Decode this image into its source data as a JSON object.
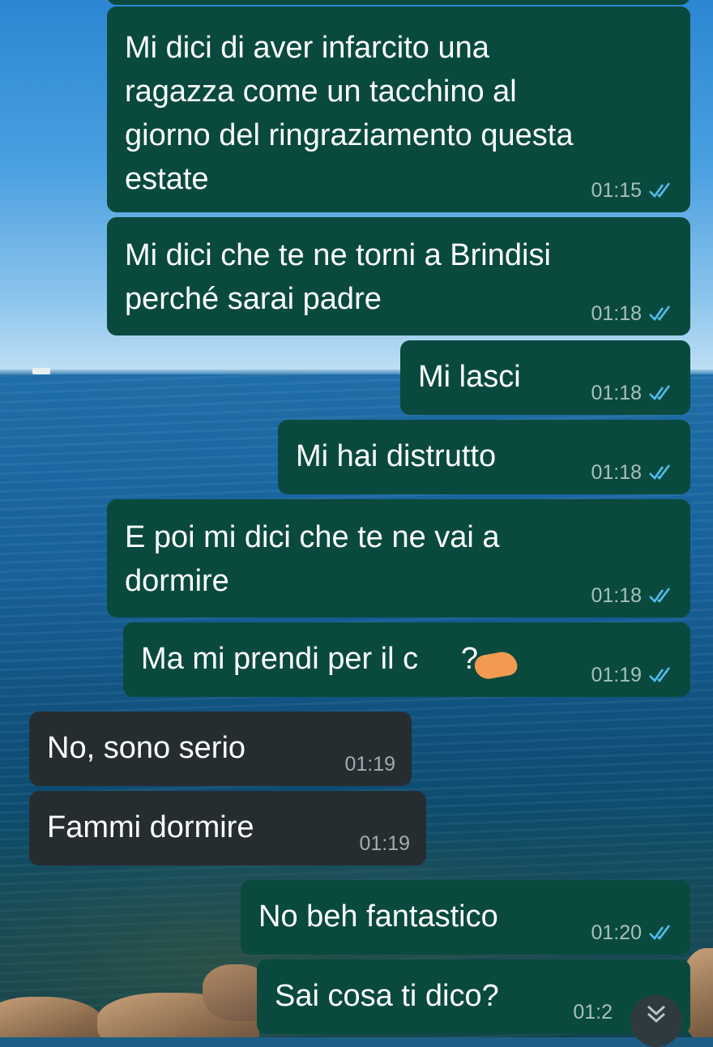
{
  "chat": {
    "messages": [
      {
        "direction": "out",
        "text": "Mi dici di aver infarcito una\nragazza come un tacchino al\ngiorno del ringraziamento questa\nestate",
        "time": "01:15",
        "status": "read-ticks"
      },
      {
        "direction": "out",
        "text": "Mi dici che te ne torni a Brindisi\nperché sarai padre",
        "time": "01:18",
        "status": "read-ticks"
      },
      {
        "direction": "out",
        "text": "Mi lasci",
        "time": "01:18",
        "status": "read-ticks"
      },
      {
        "direction": "out",
        "text": "Mi hai distrutto",
        "time": "01:18",
        "status": "read-ticks"
      },
      {
        "direction": "out",
        "text": "E poi mi dici che te ne vai a\ndormire",
        "time": "01:18",
        "status": "read-ticks"
      },
      {
        "direction": "out",
        "text": "Ma mi prendi per il c     ?",
        "time": "01:19",
        "status": "read-ticks",
        "note_redacted": true
      },
      {
        "direction": "in",
        "text": "No, sono serio",
        "time": "01:19"
      },
      {
        "direction": "in",
        "text": "Fammi dormire",
        "time": "01:19"
      },
      {
        "direction": "out",
        "text": "No beh fantastico",
        "time": "01:20",
        "status": "read-ticks"
      },
      {
        "direction": "out",
        "text": "Sai cosa ti dico?",
        "time": "01:2",
        "status": "read-ticks"
      }
    ]
  },
  "colors": {
    "outgoing_bubble": "#0a4a3e",
    "incoming_bubble": "#262d31",
    "read_tick": "#53bdeb",
    "redaction": "#f29a52"
  },
  "icons": {
    "read_receipt": "double-check-icon",
    "scroll_down": "chevron-double-down-icon"
  }
}
